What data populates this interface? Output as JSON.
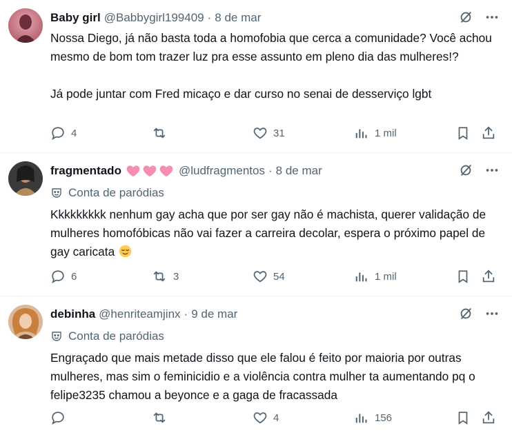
{
  "tweets": [
    {
      "name": "Baby girl",
      "handle": "@Babbygirl199409",
      "date": "8 de mar",
      "parody": "",
      "text": "Nossa Diego, já não basta toda a homofobia que cerca a comunidade? Você achou mesmo de bom tom trazer luz pra esse assunto em pleno dia das mulheres!?\n\nJá pode juntar com Fred micaço e dar curso no senai de desserviço lgbt",
      "replies": "4",
      "reposts": "",
      "likes": "31",
      "views": "1 mil"
    },
    {
      "name": "fragmentado",
      "handle": "@ludfragmentos",
      "date": "8 de mar",
      "parody": "Conta de paródias",
      "text": "Kkkkkkkkk nenhum gay acha que por ser gay não é machista, querer validação de mulheres homofóbicas não vai fazer a carreira decolar, espera o próximo papel de gay caricata",
      "replies": "6",
      "reposts": "3",
      "likes": "54",
      "views": "1 mil"
    },
    {
      "name": "debinha",
      "handle": "@henriteamjinx",
      "date": "9 de mar",
      "parody": "Conta de paródias",
      "text": "Engraçado que  mais metade disso que ele falou é feito por maioria por outras mulheres, mas sim o feminicidio e a violência contra mulher ta aumentando pq o felipe3235 chamou a beyonce e a gaga de fracassada",
      "replies": "",
      "reposts": "",
      "likes": "4",
      "views": "156"
    }
  ],
  "separator": "·",
  "colors": {
    "text": "#0f1419",
    "secondary": "#536471",
    "border": "#eff3f4",
    "heart_emoji": "#f48fb1"
  }
}
